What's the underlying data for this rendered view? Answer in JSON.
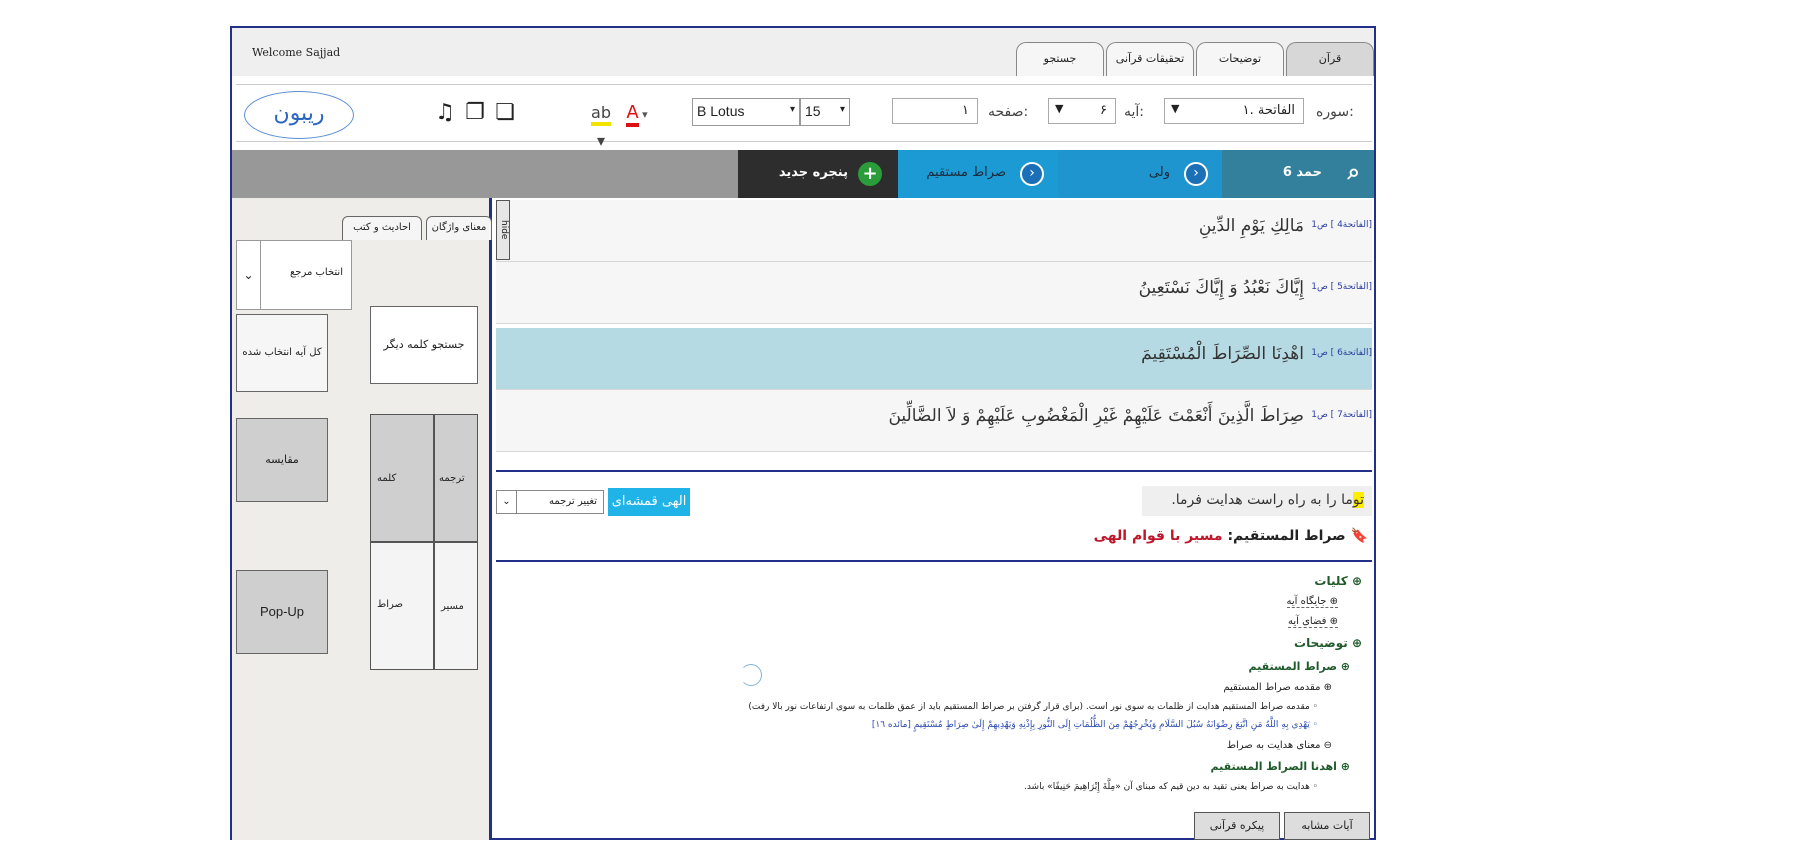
{
  "top": {
    "welcome": "Welcome Sajjad",
    "tabs": [
      "قرآن",
      "توضیحات",
      "تحقیقات قرآنی",
      "جستجو"
    ]
  },
  "toolbar": {
    "sura_label": "سوره:",
    "sura_value": "۱. الفاتحة",
    "aye_label": "آیه:",
    "aye_value": "۶",
    "page_label": "صفحه:",
    "page_value": "۱",
    "font_name": "B Lotus",
    "font_size": "15",
    "logo_text": "ریبون"
  },
  "nav": {
    "new_window": "پنجره جدید",
    "step1": "صراط مستقیم",
    "step2": "ولی",
    "step3": "حمد 6"
  },
  "left_panel": {
    "tab_vocab": "معنای واژگان",
    "tab_hadith": "احادیث و کتب",
    "ref_select": "انتخاب مرجع",
    "search_other": "جستجو کلمه دیگر",
    "whole_verse": "کل آیه انتخاب شده",
    "compare": "مقایسه",
    "popup": "Pop-Up",
    "grid": {
      "translation": "ترجمه",
      "word": "کلمه",
      "path": "مسیر",
      "sirat": "صراط"
    },
    "hide": "hide"
  },
  "verses": [
    {
      "text": "مَالِكِ يَوْمِ الدِّينِ",
      "ref": "[الفاتحة4 ] ص1"
    },
    {
      "text": "إِيَّاكَ نَعْبُدُ وَ إِيَّاكَ نَسْتَعِينُ",
      "ref": "[الفاتحة5 ] ص1"
    },
    {
      "text": "اهْدِنَا الصِّرَاطَ الْمُسْتَقِيمَ",
      "ref": "[الفاتحة6 ] ص1"
    },
    {
      "text": "صِرَاطَ الَّذِينَ أَنْعَمْتَ عَلَيْهِمْ غَيْرِ الْمَغْضُوبِ عَلَيْهِمْ وَ لاَ الضَّالِّينَ",
      "ref": "[الفاتحة7 ] ص1"
    }
  ],
  "translation": {
    "hl": "تو",
    "rest": "ما را به راه راست هدایت فرما.",
    "translator": "الهی قمشه‌ای",
    "change": "تغییر ترجمه"
  },
  "subject": {
    "key": "صراط المستقیم:",
    "value": "مسیر با قوام الهی"
  },
  "tree": {
    "kolliyat": "کلیات",
    "jaygah": "جایگاه آیه",
    "faza": "فضای آیه",
    "tozihat": "توضیحات",
    "sirat_mostaqim": "صراط المستقیم",
    "moqaddame": "مقدمه صراط المستقیم",
    "moqaddame_text": "مقدمه صراط المستقیم هدایت از ظلمات به سوی نور است. (برای قرار گرفتن بر صراط المستقیم باید از عمق ظلمات به سوی ارتفاعات نور بالا رفت)",
    "verse_quote": "يَهْدِي بِهِ اللَّهُ مَنِ اتَّبَعَ رِضْوَانَهُ سُبُلَ السَّلَامِ وَيُخْرِجُهُمْ مِنَ الظُّلُمَاتِ إِلَى النُّورِ بِإِذْنِهِ وَيَهْدِيهِمْ إِلَىٰ صِرَاطٍ مُسْتَقِيمٍ [مائده ١٦]",
    "mana": "معنای هدایت به صراط",
    "ehdena": "اهدنا الصراط المستقیم",
    "ehdena_text": "هدایت به صراط یعنی تقید به دین قیم که مبنای آن «مِلَّةَ إِبْرَاهِيمَ حَنِيفًا» باشد."
  },
  "bottom": {
    "similar": "آیات مشابه",
    "corpus": "پیکره قرآنی"
  }
}
